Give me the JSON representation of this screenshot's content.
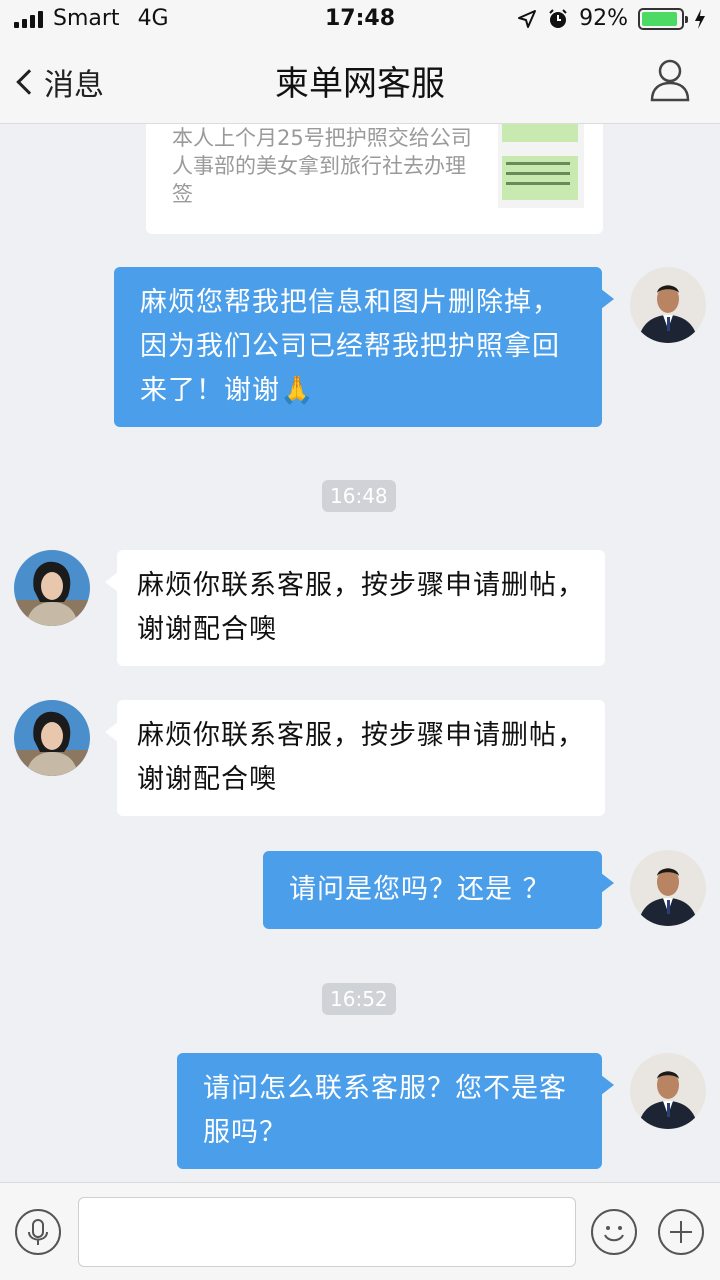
{
  "status_bar": {
    "carrier": "Smart",
    "network": "4G",
    "time": "17:48",
    "battery": "92%",
    "battery_level": 0.92
  },
  "nav": {
    "back_label": "消息",
    "title": "柬单网客服"
  },
  "quoted_card": {
    "text": "本人上个月25号把护照交给公司人事部的美女拿到旅行社去办理签"
  },
  "messages": [
    {
      "side": "me",
      "text": "麻烦您帮我把信息和图片删除掉，因为我们公司已经帮我把护照拿回来了！谢谢🙏"
    },
    {
      "timestamp": "16:48"
    },
    {
      "side": "them",
      "text": "麻烦你联系客服，按步骤申请删帖，谢谢配合噢"
    },
    {
      "side": "them",
      "text": "麻烦你联系客服，按步骤申请删帖，谢谢配合噢"
    },
    {
      "side": "me",
      "text": "请问是您吗？还是 ？"
    },
    {
      "timestamp": "16:52"
    },
    {
      "side": "me",
      "text": "请问怎么联系客服？您不是客服吗？"
    }
  ],
  "input": {
    "placeholder": ""
  },
  "colors": {
    "my_bubble": "#4a9eea",
    "their_bubble": "#ffffff",
    "background": "#eef0f3",
    "battery": "#4cd964"
  }
}
